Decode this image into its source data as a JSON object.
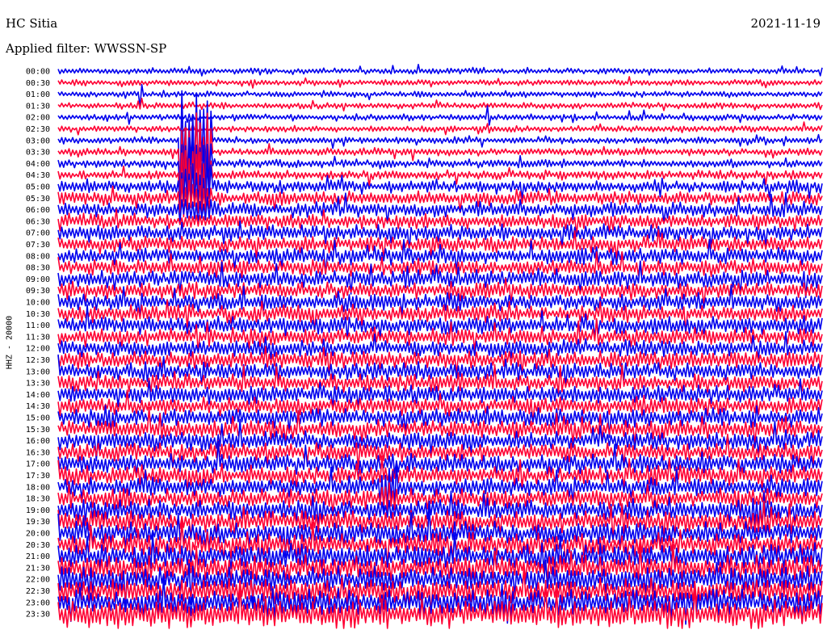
{
  "header": {
    "station": "HC Sitia",
    "date": "2021-11-19",
    "filter": "Applied filter: WWSSN-SP",
    "channel": "HHZ - 20000"
  },
  "chart_data": {
    "type": "line",
    "title": "HC Sitia",
    "ylabel": "HHZ - 20000",
    "row_labels": [
      "00:00",
      "00:30",
      "01:00",
      "01:30",
      "02:00",
      "02:30",
      "03:00",
      "03:30",
      "04:00",
      "04:30",
      "05:00",
      "05:30",
      "06:00",
      "06:30",
      "07:00",
      "07:30",
      "08:00",
      "08:30",
      "09:00",
      "09:30",
      "10:00",
      "10:30",
      "11:00",
      "11:30",
      "12:00",
      "12:30",
      "13:00",
      "13:30",
      "14:00",
      "14:30",
      "15:00",
      "15:30",
      "16:00",
      "16:30",
      "17:00",
      "17:30",
      "18:00",
      "18:30",
      "19:00",
      "19:30",
      "20:00",
      "20:30",
      "21:00",
      "21:30",
      "22:00",
      "22:30",
      "23:00",
      "23:30"
    ],
    "series_colors": [
      "#0000ee",
      "#ff0033"
    ],
    "row_amplitude": [
      0.35,
      0.35,
      0.35,
      0.38,
      0.38,
      0.38,
      0.4,
      0.45,
      0.5,
      0.55,
      0.75,
      0.85,
      0.9,
      0.9,
      0.95,
      0.95,
      1.0,
      1.0,
      1.0,
      1.0,
      1.05,
      1.05,
      1.05,
      1.05,
      1.05,
      1.05,
      1.05,
      1.05,
      1.1,
      1.1,
      1.1,
      1.1,
      1.1,
      1.1,
      1.15,
      1.15,
      1.15,
      1.2,
      1.25,
      1.3,
      1.35,
      1.4,
      1.45,
      1.5,
      1.55,
      1.6,
      1.65,
      1.7
    ],
    "events": [
      {
        "row": 6,
        "start": 0.158,
        "end": 0.2,
        "amplitude": 5.0,
        "decay_rows": 7
      },
      {
        "row": 36,
        "start": 0.42,
        "end": 0.445,
        "amplitude": 2.4,
        "decay_rows": 2
      },
      {
        "row": 2,
        "start": 0.105,
        "end": 0.11,
        "amplitude": 1.6,
        "decay_rows": 1
      },
      {
        "row": 4,
        "start": 0.56,
        "end": 0.565,
        "amplitude": 1.4,
        "decay_rows": 1
      },
      {
        "row": 38,
        "start": 0.905,
        "end": 0.93,
        "amplitude": 1.6,
        "decay_rows": 3
      }
    ]
  }
}
